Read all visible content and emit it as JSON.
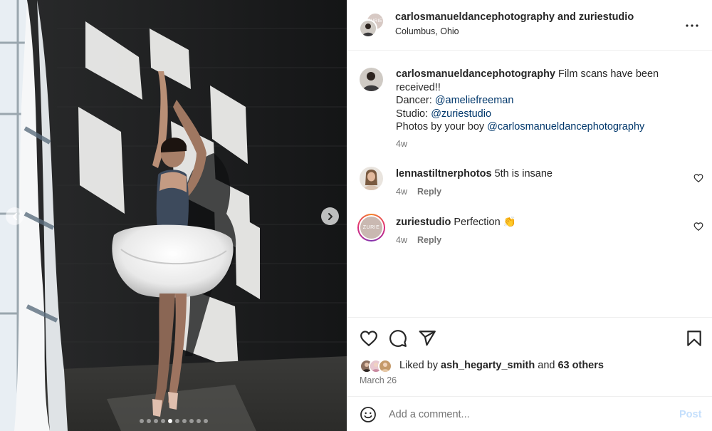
{
  "post": {
    "author_primary": "carlosmanueldancephotography",
    "joiner": "and",
    "author_secondary": "zuriestudio",
    "location": "Columbus, Ohio",
    "studio_avatar_text": "ZURIE"
  },
  "carousel": {
    "slide_count": 10,
    "active_index": 4
  },
  "caption": {
    "username": "carlosmanueldancephotography",
    "text_line1": "Film scans have been received!!",
    "dancer_label": "Dancer:",
    "dancer_handle": "@ameliefreeman",
    "studio_label": "Studio:",
    "studio_handle": "@zuriestudio",
    "photos_label": "Photos by your boy",
    "photos_handle": "@carlosmanueldancephotography",
    "time": "4w"
  },
  "comments": [
    {
      "username": "lennastiltnerphotos",
      "text": "5th is insane",
      "time": "4w",
      "reply": "Reply"
    },
    {
      "username": "zuriestudio",
      "text": "Perfection 👏",
      "time": "4w",
      "reply": "Reply",
      "avatar_text": "ZURIE"
    }
  ],
  "likes": {
    "prefix": "Liked by",
    "user": "ash_hegarty_smith",
    "joiner": "and",
    "others": "63 others",
    "date": "March 26"
  },
  "composer": {
    "placeholder": "Add a comment...",
    "post_label": "Post"
  },
  "icons": [
    "chevron-left-icon",
    "chevron-right-icon",
    "more-icon",
    "heart-icon",
    "comment-icon",
    "share-icon",
    "bookmark-icon",
    "emoji-icon"
  ],
  "colors": {
    "link": "#00376b",
    "muted": "#737373",
    "post_disabled": "#c4dffc",
    "text": "#262626"
  }
}
